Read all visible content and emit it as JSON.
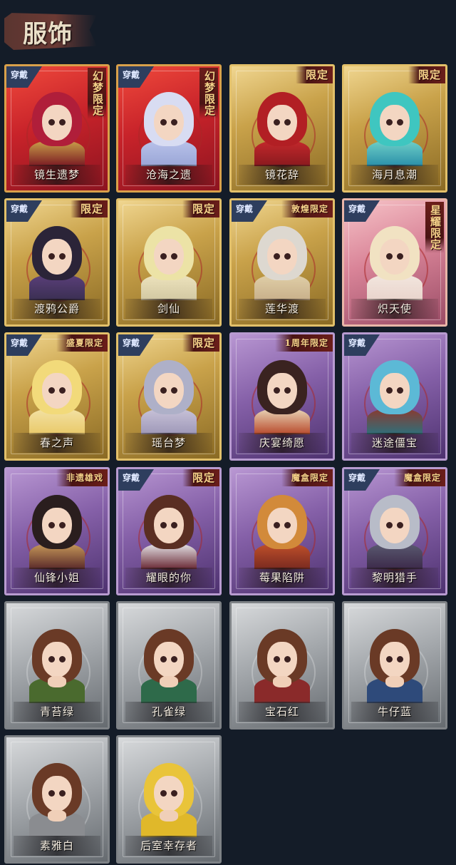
{
  "page": {
    "title": "服饰"
  },
  "badge_text": "穿戴",
  "cards": [
    {
      "name": "镜生遗梦",
      "theme": "red",
      "badge": true,
      "tag": "幻梦限定",
      "tag_style": "vert",
      "hair": "#b01e3a",
      "body": "#7a1a22",
      "outfit": "#caa04a"
    },
    {
      "name": "沧海之遗",
      "theme": "red",
      "badge": true,
      "tag": "幻梦限定",
      "tag_style": "vert",
      "hair": "#d8dcf2",
      "body": "#9aa6d6",
      "outfit": "#b8c2ea"
    },
    {
      "name": "镜花辞",
      "theme": "gold",
      "badge": false,
      "tag": "限定",
      "tag_style": "row",
      "hair": "#b21f24",
      "body": "#8a1a1e",
      "outfit": "#c4282c"
    },
    {
      "name": "海月息潮",
      "theme": "gold",
      "badge": false,
      "tag": "限定",
      "tag_style": "row",
      "hair": "#3fc6c0",
      "body": "#2a8fa8",
      "outfit": "#6fd0c8"
    },
    {
      "name": "渡鸦公爵",
      "theme": "gold",
      "badge": true,
      "tag": "限定",
      "tag_style": "row",
      "hair": "#2b2438",
      "body": "#3a2f52",
      "outfit": "#5b3f7a"
    },
    {
      "name": "剑仙",
      "theme": "gold",
      "badge": false,
      "tag": "限定",
      "tag_style": "row",
      "hair": "#ece3a6",
      "body": "#d2c8a2",
      "outfit": "#ede3bd"
    },
    {
      "name": "莲华渡",
      "theme": "gold",
      "badge": true,
      "tag": "敦煌限定",
      "tag_style": "row",
      "hair": "#ddd8d0",
      "body": "#c8b08a",
      "outfit": "#e0cfa8"
    },
    {
      "name": "炽天使",
      "theme": "pink",
      "badge": true,
      "tag": "星耀限定",
      "tag_style": "vert",
      "hair": "#f1e2c2",
      "body": "#e9d4cc",
      "outfit": "#f2e6de"
    },
    {
      "name": "春之声",
      "theme": "gold",
      "badge": true,
      "tag": "盛夏限定",
      "tag_style": "row",
      "hair": "#f2da7a",
      "body": "#e9c96a",
      "outfit": "#f3e2a4"
    },
    {
      "name": "瑶台梦",
      "theme": "gold",
      "badge": true,
      "tag": "限定",
      "tag_style": "row",
      "hair": "#aeb0c8",
      "body": "#9e98b8",
      "outfit": "#c8c2d8"
    },
    {
      "name": "庆宴绮愿",
      "theme": "purple",
      "badge": false,
      "tag": "1周年限定",
      "tag_style": "row",
      "hair": "#3a2320",
      "body": "#b84a2c",
      "outfit": "#e9d6b8"
    },
    {
      "name": "迷途僵宝",
      "theme": "purple",
      "badge": true,
      "tag": "",
      "tag_style": "row",
      "hair": "#5cb9d6",
      "body": "#2f6f7a",
      "outfit": "#8a3a30"
    },
    {
      "name": "仙锋小姐",
      "theme": "purple",
      "badge": false,
      "tag": "非遗雄戏",
      "tag_style": "row",
      "hair": "#2a1e1e",
      "body": "#5a2a2a",
      "outfit": "#c89a5a"
    },
    {
      "name": "耀眼的你",
      "theme": "purple",
      "badge": true,
      "tag": "限定",
      "tag_style": "row",
      "hair": "#5a2e22",
      "body": "#6a2a36",
      "outfit": "#e6e6ea"
    },
    {
      "name": "莓果陷阱",
      "theme": "purple",
      "badge": false,
      "tag": "魔盒限定",
      "tag_style": "row",
      "hair": "#d28a3a",
      "body": "#7a2a20",
      "outfit": "#c0502a"
    },
    {
      "name": "黎明猎手",
      "theme": "purple",
      "badge": true,
      "tag": "魔盒限定",
      "tag_style": "row",
      "hair": "#b8bcc8",
      "body": "#3c2a4a",
      "outfit": "#5a5a70"
    },
    {
      "name": "青苔绿",
      "theme": "gray",
      "badge": false,
      "tag": "",
      "tag_style": "row",
      "hair": "#6a3a26",
      "body": "#4a6a2e",
      "outfit": "#4a6a2e"
    },
    {
      "name": "孔雀绿",
      "theme": "gray",
      "badge": false,
      "tag": "",
      "tag_style": "row",
      "hair": "#6a3a26",
      "body": "#2e6a4a",
      "outfit": "#2e6a4a"
    },
    {
      "name": "宝石红",
      "theme": "gray",
      "badge": false,
      "tag": "",
      "tag_style": "row",
      "hair": "#6a3a26",
      "body": "#8a2a2a",
      "outfit": "#8a2a2a"
    },
    {
      "name": "牛仔蓝",
      "theme": "gray",
      "badge": false,
      "tag": "",
      "tag_style": "row",
      "hair": "#6a3a26",
      "body": "#2e4a7a",
      "outfit": "#2e4a7a"
    },
    {
      "name": "素雅白",
      "theme": "gray",
      "badge": false,
      "tag": "",
      "tag_style": "row",
      "hair": "#6a3a26",
      "body": "#8a8c90",
      "outfit": "#8a8c90"
    },
    {
      "name": "后室幸存者",
      "theme": "gray",
      "badge": false,
      "tag": "",
      "tag_style": "row",
      "hair": "#e9c43a",
      "body": "#e0b82a",
      "outfit": "#e0b82a"
    }
  ]
}
